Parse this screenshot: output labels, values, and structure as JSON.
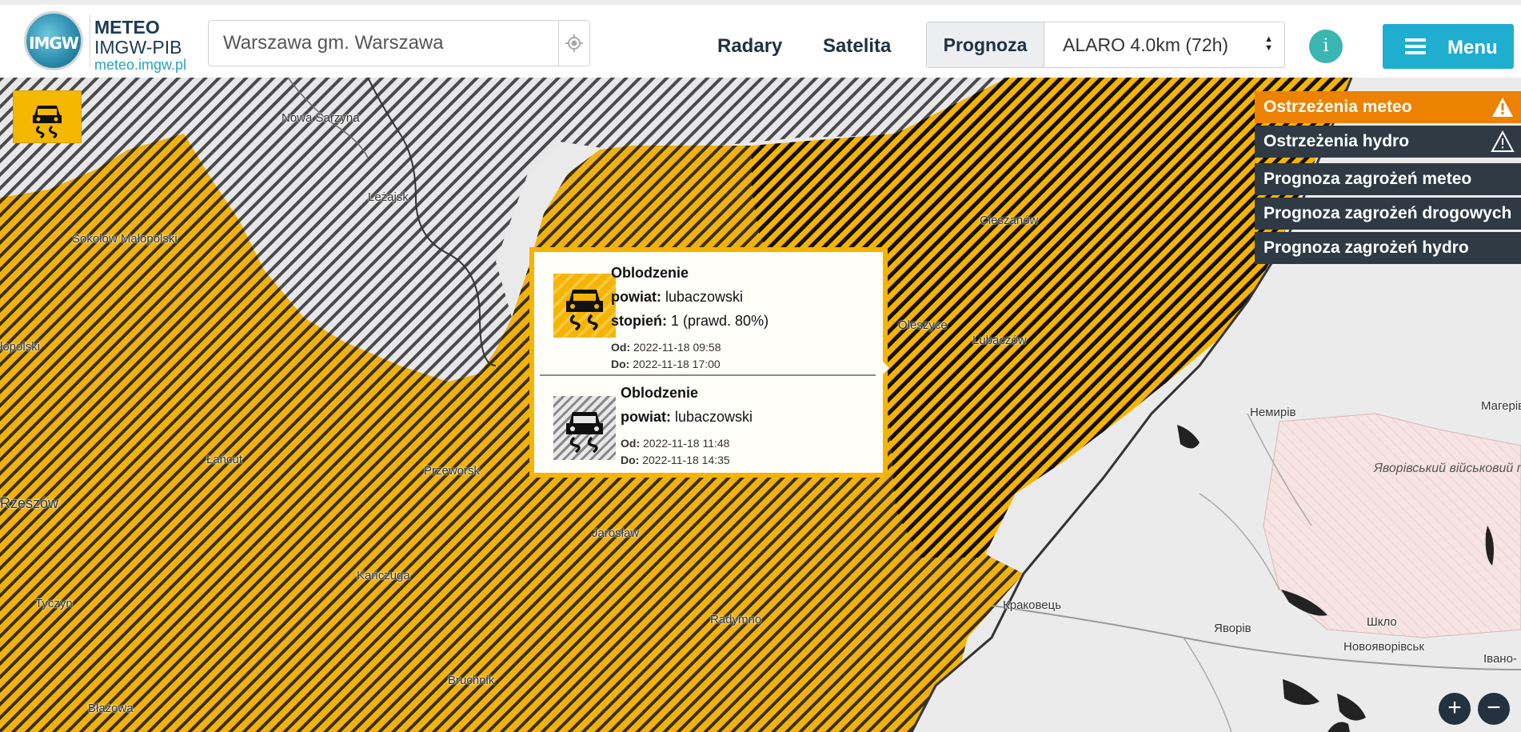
{
  "logo": {
    "emblem_text": "IMGW",
    "line1": "METEO",
    "line2": "IMGW-PIB",
    "line3": "meteo.imgw.pl"
  },
  "search": {
    "value": "Warszawa gm. Warszawa"
  },
  "nav": {
    "radary": "Radary",
    "satelita": "Satelita"
  },
  "forecast": {
    "label": "Prognoza",
    "selected_model": "ALARO 4.0km (72h)"
  },
  "info_button": {
    "symbol": "i"
  },
  "menu_button": {
    "label": "Menu"
  },
  "layers": [
    {
      "label": "Ostrzeżenia meteo",
      "active": true,
      "icon": "warning-icon"
    },
    {
      "label": "Ostrzeżenia hydro",
      "active": false,
      "icon": "warning-outline-icon"
    },
    {
      "label": "Prognoza zagrożeń meteo",
      "active": false
    },
    {
      "label": "Prognoza zagrożeń drogowych",
      "active": false
    },
    {
      "label": "Prognoza zagrożeń hydro",
      "active": false
    }
  ],
  "popup": {
    "current": {
      "title": "Oblodzenie",
      "powiat_label": "powiat:",
      "powiat": "lubaczowski",
      "stopien_label": "stopień:",
      "stopien": "1 (prawd. 80%)",
      "od_label": "Od:",
      "od": "2022-11-18 09:58",
      "do_label": "Do:",
      "do": "2022-11-18 17:00"
    },
    "past": {
      "title": "Oblodzenie",
      "powiat_label": "powiat:",
      "powiat": "lubaczowski",
      "od_label": "Od:",
      "od": "2022-11-18 11:48",
      "do_label": "Do:",
      "do": "2022-11-18 14:35"
    }
  },
  "map_labels": {
    "nowa_sarzyna": "Nowa Sarzyna",
    "lezajsk": "Leżajsk",
    "sokolow": "Sokołów Małopolski",
    "malopolski": "łopolski",
    "lancut": "Łańcut",
    "rzeszow": "Rzeszów",
    "przeworsk": "Przeworsk",
    "jaroslaw": "Jarosław",
    "kanczuga": "Kańczuga",
    "tyczyn": "Tyczyn",
    "radymno": "Radymno",
    "bruchnik": "Bruchnik",
    "blazowa": "Błażowa",
    "cieszanow": "Cieszanów",
    "oleszyce": "Oleszyce",
    "lubaczow": "Lubaczów",
    "nemyriv": "Немирів",
    "mageriv": "Магерів",
    "polygon": "Яворівський військовий полігон",
    "krakovets": "Краковець",
    "yavoriv": "Яворів",
    "shklo": "Шкло",
    "novoyavorivsk": "Новояворівськ",
    "ivano": "Івано-"
  },
  "zoom": {
    "in": "+",
    "out": "−"
  },
  "colors": {
    "warning_yellow": "#f5b400",
    "active_layer": "#ec8200",
    "panel_dark": "#2f3a45",
    "menu_blue": "#1faecf",
    "info_teal": "#3ab5b2"
  }
}
